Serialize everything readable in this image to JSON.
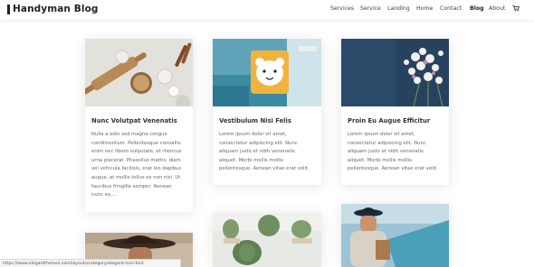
{
  "site": {
    "title": "Handyman Blog"
  },
  "nav": {
    "items": [
      {
        "label": "Services",
        "active": false
      },
      {
        "label": "Service",
        "active": false
      },
      {
        "label": "Landing",
        "active": false
      },
      {
        "label": "Home",
        "active": false
      },
      {
        "label": "Contact",
        "active": false
      },
      {
        "label": "Blog",
        "active": true
      },
      {
        "label": "About",
        "active": false
      }
    ],
    "cart_icon": "shopping-cart-icon"
  },
  "posts": [
    {
      "title": "Nunc Volutpat Venenatis",
      "excerpt_lines": [
        "Nulla a odio sed magna congue",
        "condimentum. Pellentesque convallis",
        "enim nec libero vulputate, et rhoncus",
        "urna placerat. Phasellus mattis, diam",
        "vel vehicula facilisis, erat leo dapibus",
        "augue, at mollis tellus ex non nisi. Ut",
        "faucibus fringilla semper. Aenean",
        "nunc ex,..."
      ]
    },
    {
      "title": "Vestibulum Nisi Felis",
      "excerpt_lines": [
        "Lorem ipsum dolor sit amet,",
        "consectetur adipiscing elit. Nunc",
        "aliquam justo et nibh venenatis",
        "aliquet. Morbi mollis mollis",
        "pellentesque. Aenean vitae erat velit."
      ]
    },
    {
      "title": "Proin Eu Augue Efficitur",
      "excerpt_lines": [
        "Lorem ipsum dolor sit amet,",
        "consectetur adipiscing elit. Nunc",
        "aliquam justo et nibh venenatis",
        "aliquet. Morbi mollis mollis",
        "pellentesque. Aenean vitae erat velit."
      ]
    }
  ],
  "status_bar": {
    "url": "https://www.elegantthemes.com/layouts/category/elegant-icon-font"
  },
  "colors": {
    "header_bg": "#ffffff",
    "page_bg": "#ffffff",
    "title_text": "#333333",
    "body_text": "#666666"
  }
}
